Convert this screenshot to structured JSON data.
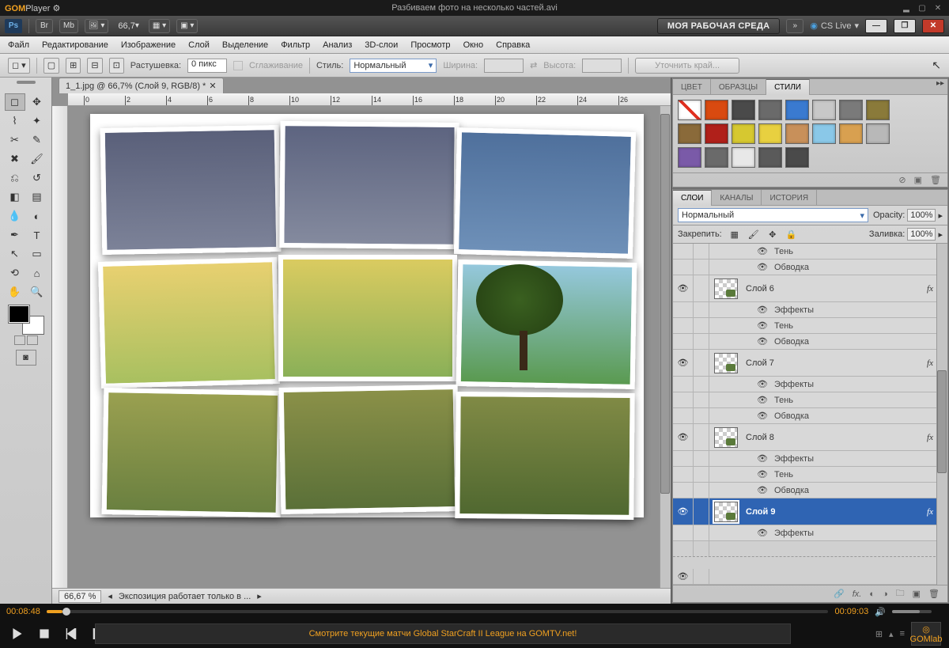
{
  "gom": {
    "logo": "GOMPlayer",
    "title": "Разбиваем фото на несколько частей.avi",
    "time_cur": "00:08:48",
    "time_total": "00:09:03",
    "ad": "Смотрите текущие матчи Global StarCraft II League на GOMTV.net!",
    "lab": "GOMlab"
  },
  "ps": {
    "top": {
      "ps": "Ps",
      "br": "Br",
      "mb": "Mb",
      "zoom": "66,7",
      "workspace": "МОЯ РАБОЧАЯ СРЕДА",
      "cslive": "CS Live"
    },
    "menu": [
      "Файл",
      "Редактирование",
      "Изображение",
      "Слой",
      "Выделение",
      "Фильтр",
      "Анализ",
      "3D-слои",
      "Просмотр",
      "Окно",
      "Справка"
    ],
    "opts": {
      "feather_lbl": "Растушевка:",
      "feather_val": "0 пикс",
      "antialias": "Сглаживание",
      "style_lbl": "Стиль:",
      "style_val": "Нормальный",
      "width_lbl": "Ширина:",
      "height_lbl": "Высота:",
      "refine": "Уточнить край..."
    },
    "doc": {
      "tab": "1_1.jpg @ 66,7% (Слой 9, RGB/8) *",
      "status_zoom": "66,67 %",
      "status_info": "Экспозиция работает только в ..."
    },
    "ruler": [
      "0",
      "2",
      "4",
      "6",
      "8",
      "10",
      "12",
      "14",
      "16",
      "18",
      "20",
      "22",
      "24",
      "26"
    ],
    "panel_styles": {
      "tabs": [
        "ЦВЕТ",
        "ОБРАЗЦЫ",
        "СТИЛИ"
      ],
      "colors": [
        "none",
        "#d94a10",
        "#4a4a4a",
        "#6a6a6a",
        "#3a7ad0",
        "#c8c8c8",
        "#7a7a7a",
        "#8a7a3a",
        "#8a6a3a",
        "#b0201a",
        "#d6c830",
        "#e8d040",
        "#c8905a",
        "#8ac8e8",
        "#d8a050",
        "#b8b8b8",
        "#7a5aa8",
        "#6a6a6a",
        "#e8e8e8",
        "#5a5a5a",
        "#4a4a4a"
      ]
    },
    "panel_layers": {
      "tabs": [
        "СЛОИ",
        "КАНАЛЫ",
        "ИСТОРИЯ"
      ],
      "mode": "Нормальный",
      "opacity_lbl": "Opacity:",
      "opacity_val": "100%",
      "lock_lbl": "Закрепить:",
      "fill_lbl": "Заливка:",
      "fill_val": "100%",
      "fx_lbl": "fx",
      "eff": "Эффекты",
      "shadow": "Тень",
      "stroke": "Обводка",
      "layers": [
        {
          "name": "Слой 6"
        },
        {
          "name": "Слой 7"
        },
        {
          "name": "Слой 8"
        },
        {
          "name": "Слой 9"
        }
      ]
    }
  }
}
